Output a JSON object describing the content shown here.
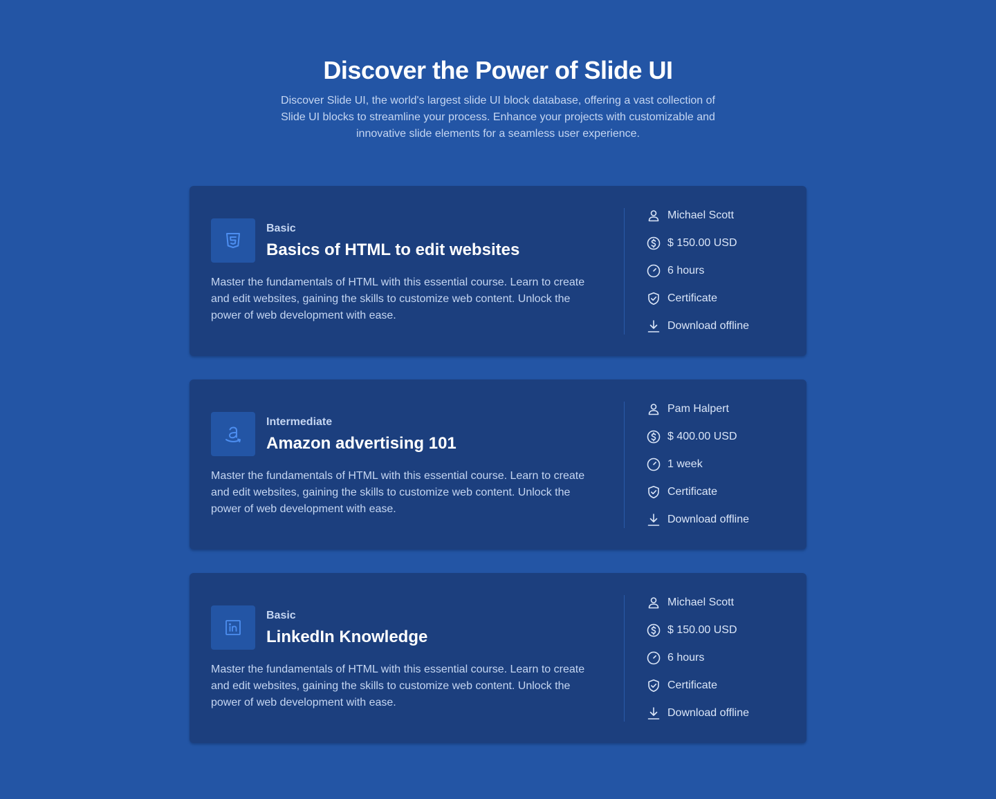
{
  "hero": {
    "title": "Discover the Power of Slide UI",
    "subtitle": "Discover Slide UI, the world's largest slide UI block database, offering a vast collection of Slide UI blocks to streamline your process. Enhance your projects with customizable and innovative slide elements for a seamless user experience."
  },
  "colors": {
    "background": "#2355a5",
    "card": "#1c3f7e",
    "muted_text": "#c5d6f2",
    "icon_accent": "#4d8ef0"
  },
  "courses": [
    {
      "icon": "html5-icon",
      "level": "Basic",
      "title": "Basics of HTML to edit websites",
      "description": "Master the fundamentals of HTML with this essential course. Learn to create and edit websites, gaining the skills to customize web content. Unlock the power of web development with ease.",
      "instructor": "Michael Scott",
      "price": "$ 150.00 USD",
      "duration": "6 hours",
      "certificate": "Certificate",
      "download": "Download offline"
    },
    {
      "icon": "amazon-icon",
      "level": "Intermediate",
      "title": "Amazon advertising 101",
      "description": "Master the fundamentals of HTML with this essential course. Learn to create and edit websites, gaining the skills to customize web content. Unlock the power of web development with ease.",
      "instructor": "Pam Halpert",
      "price": "$ 400.00 USD",
      "duration": "1 week",
      "certificate": "Certificate",
      "download": "Download offline"
    },
    {
      "icon": "linkedin-icon",
      "level": "Basic",
      "title": "LinkedIn Knowledge",
      "description": "Master the fundamentals of HTML with this essential course. Learn to create and edit websites, gaining the skills to customize web content. Unlock the power of web development with ease.",
      "instructor": "Michael Scott",
      "price": "$ 150.00 USD",
      "duration": "6 hours",
      "certificate": "Certificate",
      "download": "Download offline"
    }
  ]
}
